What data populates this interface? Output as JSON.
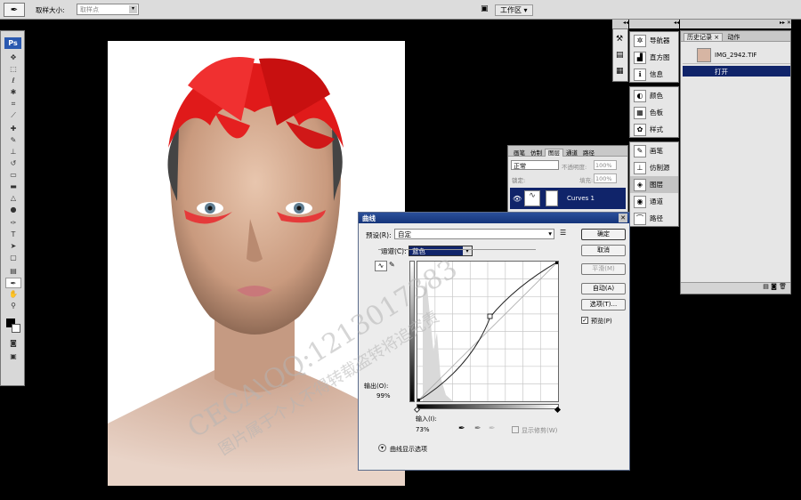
{
  "options_bar": {
    "sample_size_label": "取样大小:",
    "sample_size_value": "取样点",
    "workspace": "工作区 ▾"
  },
  "toolbox": {
    "logo": "Ps"
  },
  "right_panel_1": {
    "items": [
      "导航器",
      "直方图",
      "信息"
    ]
  },
  "right_panel_2": {
    "items": [
      "颜色",
      "色板",
      "样式"
    ]
  },
  "right_panel_3": {
    "items": [
      "画笔",
      "仿制源",
      "图层",
      "通道",
      "路径"
    ]
  },
  "history": {
    "tabs": [
      "历史记录 ×",
      "动作"
    ],
    "snapshot": "IMG_2942.TIF",
    "step": "打开"
  },
  "layers": {
    "tabs": [
      "画笔",
      "仿制",
      "图层",
      "通道",
      "路径"
    ],
    "blend_mode": "正常",
    "opacity_label": "不透明度:",
    "opacity": "100%",
    "lock_label": "锁定:",
    "fill_label": "填充:",
    "fill": "100%",
    "layer_name": "Curves 1"
  },
  "curves": {
    "title": "曲线",
    "preset_label": "预设(R):",
    "preset_value": "自定",
    "channel_label": "通道(C):",
    "channel_value": "蓝色",
    "buttons": {
      "ok": "确定",
      "cancel": "取消",
      "smooth": "平滑(M)",
      "auto": "自动(A)",
      "options": "选项(T)..."
    },
    "preview_label": "预览(P)",
    "output_label": "输出(O):",
    "output_value": "99%",
    "input_label": "输入(I):",
    "input_value": "73%",
    "show_clipping": "显示修剪(W)",
    "display_options": "曲线显示选项"
  },
  "watermark": {
    "line1": "CECA\\QQ:1213017383",
    "line2": "图片属于个人不得转载盗转将追究责"
  }
}
